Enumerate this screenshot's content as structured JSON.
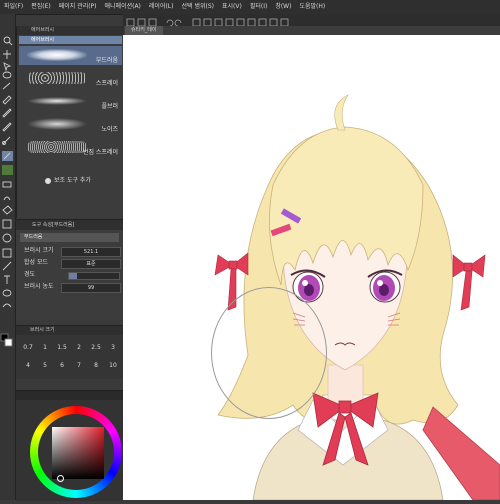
{
  "menubar": {
    "items": [
      "파일(F)",
      "편집(E)",
      "페이지 관리(P)",
      "애니메이션(A)",
      "레이어(L)",
      "선택 범위(S)",
      "표시(V)",
      "필터(I)",
      "창(W)",
      "도움말(H)"
    ]
  },
  "canvas": {
    "tab_label": "슈타키_테이"
  },
  "subtool": {
    "group_label": "에어브러시",
    "active_label": "에어브러시",
    "brushes": [
      {
        "name": "부드러움",
        "selected": true
      },
      {
        "name": "스프레이",
        "selected": false
      },
      {
        "name": "플브러",
        "selected": false
      },
      {
        "name": "노이즈",
        "selected": false
      },
      {
        "name": "번짐 스프레이",
        "selected": false
      }
    ],
    "add_label": "보조 도구 추가"
  },
  "tool_property": {
    "title": "도구 속성[부드러움]",
    "brush_name": "부드러움",
    "brush_size_label": "브러시 크기",
    "brush_size_value": "521.1",
    "blend_mode_label": "합성 모드",
    "blend_mode_value": "표준",
    "hardness_label": "경도",
    "hardness_level": 0.15,
    "density_label": "브러시 농도",
    "density_value": "99"
  },
  "brush_size_panel": {
    "title": "브러시 크기",
    "sizes": [
      "0.7",
      "1",
      "1.5",
      "2",
      "2.5",
      "3",
      "4",
      "5",
      "6",
      "7",
      "8",
      "10"
    ]
  },
  "colors": {
    "accent": "#6f85a8",
    "panel": "#3c3c3c",
    "menubar": "#2f2f2f",
    "main_color": "#e01e2a"
  }
}
